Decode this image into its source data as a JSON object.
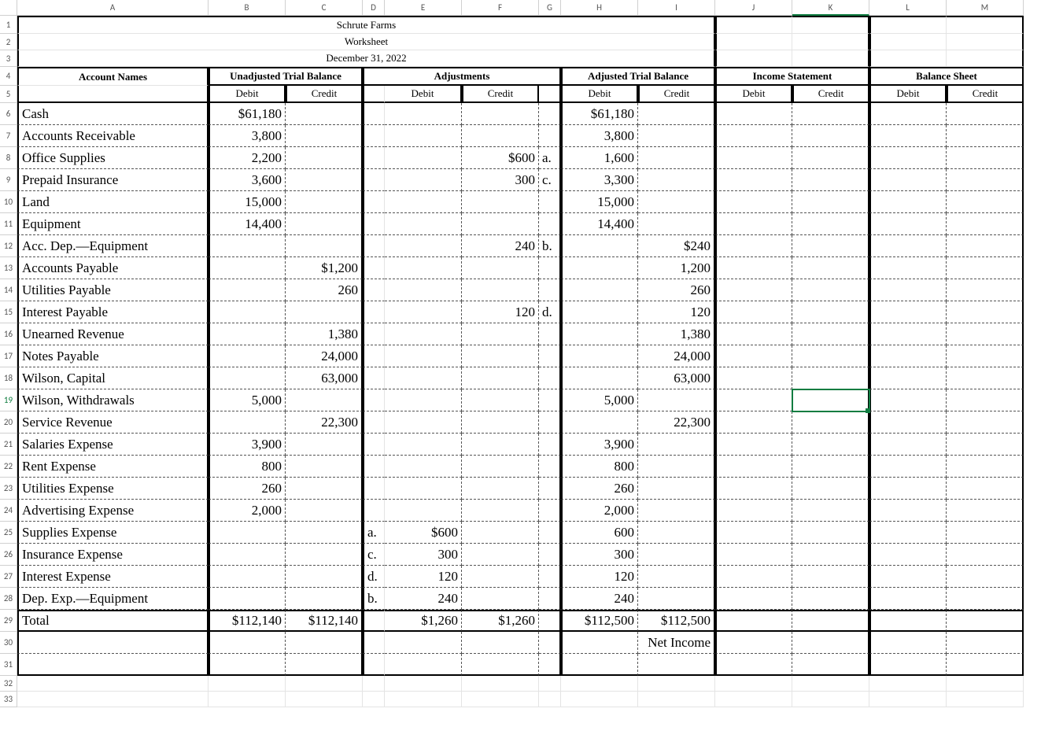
{
  "columns": [
    "A",
    "B",
    "C",
    "D",
    "E",
    "F",
    "G",
    "H",
    "I",
    "J",
    "K",
    "L",
    "M"
  ],
  "title_rows": {
    "r1": "Schrute Farms",
    "r2": "Worksheet",
    "r3": "December 31, 2022"
  },
  "section_headers": {
    "account_names": "Account Names",
    "unadj": "Unadjusted Trial Balance",
    "adj": "Adjustments",
    "adj_tb": "Adjusted Trial Balance",
    "is": "Income Statement",
    "bs": "Balance Sheet",
    "debit": "Debit",
    "credit": "Credit"
  },
  "rows": [
    {
      "n": 6,
      "a": "Cash",
      "b": "$61,180",
      "c": "",
      "d": "",
      "e": "",
      "f": "",
      "g": "",
      "h": "$61,180",
      "i": ""
    },
    {
      "n": 7,
      "a": "Accounts Receivable",
      "b": "3,800",
      "c": "",
      "d": "",
      "e": "",
      "f": "",
      "g": "",
      "h": "3,800",
      "i": ""
    },
    {
      "n": 8,
      "a": "Office Supplies",
      "b": "2,200",
      "c": "",
      "d": "",
      "e": "",
      "f": "$600",
      "g": "a.",
      "h": "1,600",
      "i": ""
    },
    {
      "n": 9,
      "a": "Prepaid Insurance",
      "b": "3,600",
      "c": "",
      "d": "",
      "e": "",
      "f": "300",
      "g": "c.",
      "h": "3,300",
      "i": ""
    },
    {
      "n": 10,
      "a": "Land",
      "b": "15,000",
      "c": "",
      "d": "",
      "e": "",
      "f": "",
      "g": "",
      "h": "15,000",
      "i": ""
    },
    {
      "n": 11,
      "a": "Equipment",
      "b": "14,400",
      "c": "",
      "d": "",
      "e": "",
      "f": "",
      "g": "",
      "h": "14,400",
      "i": ""
    },
    {
      "n": 12,
      "a": "Acc. Dep.—Equipment",
      "b": "",
      "c": "",
      "d": "",
      "e": "",
      "f": "240",
      "g": "b.",
      "h": "",
      "i": "$240"
    },
    {
      "n": 13,
      "a": "Accounts Payable",
      "b": "",
      "c": "$1,200",
      "d": "",
      "e": "",
      "f": "",
      "g": "",
      "h": "",
      "i": "1,200"
    },
    {
      "n": 14,
      "a": "Utilities Payable",
      "b": "",
      "c": "260",
      "d": "",
      "e": "",
      "f": "",
      "g": "",
      "h": "",
      "i": "260"
    },
    {
      "n": 15,
      "a": "Interest Payable",
      "b": "",
      "c": "",
      "d": "",
      "e": "",
      "f": "120",
      "g": "d.",
      "h": "",
      "i": "120"
    },
    {
      "n": 16,
      "a": "Unearned Revenue",
      "b": "",
      "c": "1,380",
      "d": "",
      "e": "",
      "f": "",
      "g": "",
      "h": "",
      "i": "1,380"
    },
    {
      "n": 17,
      "a": "Notes Payable",
      "b": "",
      "c": "24,000",
      "d": "",
      "e": "",
      "f": "",
      "g": "",
      "h": "",
      "i": "24,000"
    },
    {
      "n": 18,
      "a": "Wilson, Capital",
      "b": "",
      "c": "63,000",
      "d": "",
      "e": "",
      "f": "",
      "g": "",
      "h": "",
      "i": "63,000"
    },
    {
      "n": 19,
      "a": "Wilson, Withdrawals",
      "b": "5,000",
      "c": "",
      "d": "",
      "e": "",
      "f": "",
      "g": "",
      "h": "5,000",
      "i": ""
    },
    {
      "n": 20,
      "a": "Service Revenue",
      "b": "",
      "c": "22,300",
      "d": "",
      "e": "",
      "f": "",
      "g": "",
      "h": "",
      "i": "22,300"
    },
    {
      "n": 21,
      "a": "Salaries Expense",
      "b": "3,900",
      "c": "",
      "d": "",
      "e": "",
      "f": "",
      "g": "",
      "h": "3,900",
      "i": ""
    },
    {
      "n": 22,
      "a": "Rent Expense",
      "b": "800",
      "c": "",
      "d": "",
      "e": "",
      "f": "",
      "g": "",
      "h": "800",
      "i": ""
    },
    {
      "n": 23,
      "a": "Utilities Expense",
      "b": "260",
      "c": "",
      "d": "",
      "e": "",
      "f": "",
      "g": "",
      "h": "260",
      "i": ""
    },
    {
      "n": 24,
      "a": "Advertising Expense",
      "b": "2,000",
      "c": "",
      "d": "",
      "e": "",
      "f": "",
      "g": "",
      "h": "2,000",
      "i": ""
    },
    {
      "n": 25,
      "a": "Supplies Expense",
      "b": "",
      "c": "",
      "d": "a.",
      "e": "$600",
      "f": "",
      "g": "",
      "h": "600",
      "i": ""
    },
    {
      "n": 26,
      "a": "Insurance Expense",
      "b": "",
      "c": "",
      "d": "c.",
      "e": "300",
      "f": "",
      "g": "",
      "h": "300",
      "i": ""
    },
    {
      "n": 27,
      "a": "Interest Expense",
      "b": "",
      "c": "",
      "d": "d.",
      "e": "120",
      "f": "",
      "g": "",
      "h": "120",
      "i": ""
    },
    {
      "n": 28,
      "a": "Dep. Exp.—Equipment",
      "b": "",
      "c": "",
      "d": "b.",
      "e": "240",
      "f": "",
      "g": "",
      "h": "240",
      "i": ""
    }
  ],
  "totals": {
    "label": "Total",
    "b": "$112,140",
    "c": "$112,140",
    "e": "$1,260",
    "f": "$1,260",
    "h": "$112,500",
    "i": "$112,500"
  },
  "net_income_label": "Net Income",
  "selection": {
    "row": 19,
    "col": "K"
  }
}
